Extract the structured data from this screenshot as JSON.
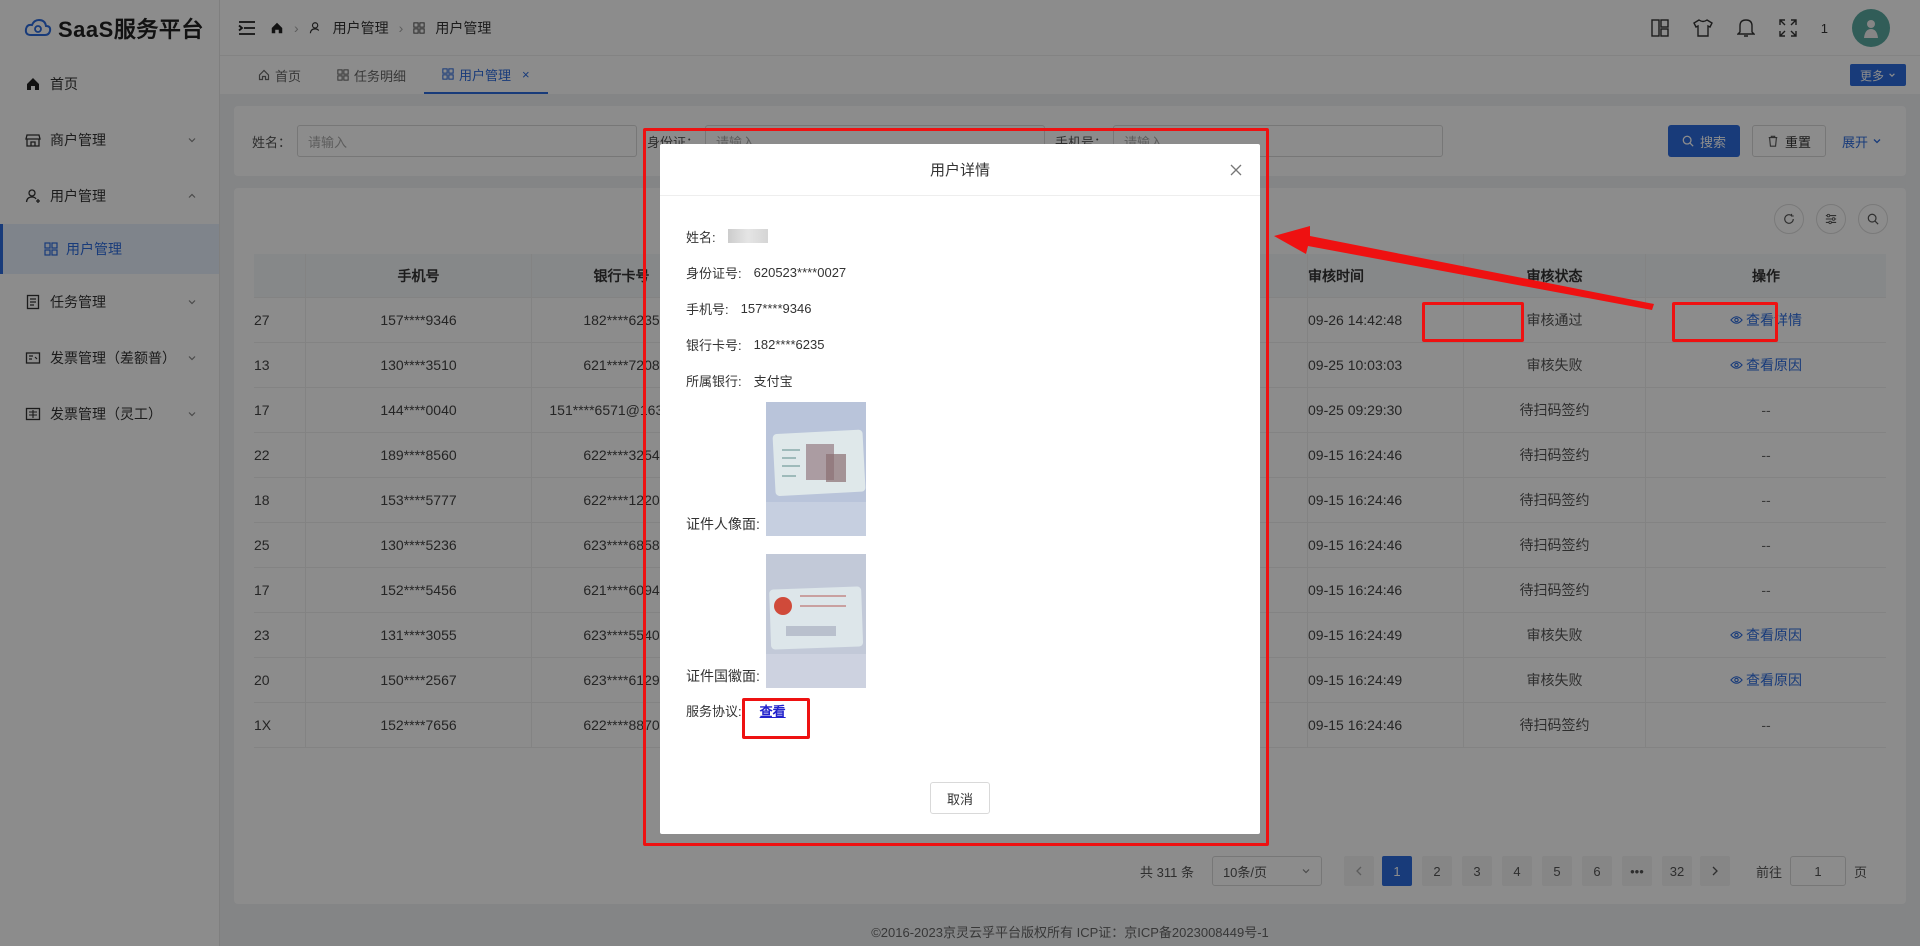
{
  "app": {
    "logo_text": "SaaS服务平台"
  },
  "sidebar": {
    "items": [
      {
        "label": "首页"
      },
      {
        "label": "商户管理"
      },
      {
        "label": "用户管理"
      },
      {
        "label": "任务管理"
      },
      {
        "label": "发票管理（差额普）"
      },
      {
        "label": "发票管理（灵工）"
      }
    ],
    "sub_active": "用户管理"
  },
  "header": {
    "breadcrumb": [
      "用户管理",
      "用户管理"
    ],
    "badge": "1"
  },
  "tabs": {
    "items": [
      {
        "label": "首页"
      },
      {
        "label": "任务明细"
      },
      {
        "label": "用户管理",
        "close": "×"
      }
    ],
    "more": "更多"
  },
  "search": {
    "name_label": "姓名：",
    "name_placeholder": "请输入",
    "id_label": "身份证：",
    "id_placeholder": "请输入",
    "phone_label": "手机号：",
    "phone_placeholder": "请输入",
    "search_btn": "搜索",
    "reset_btn": "重置",
    "expand": "展开"
  },
  "table": {
    "headers": {
      "phone": "手机号",
      "bank": "银行卡号",
      "time": "审核时间",
      "status": "审核状态",
      "op": "操作"
    },
    "rows": [
      {
        "id": "27",
        "phone": "157****9346",
        "bank": "182****6235",
        "time": "09-26 14:42:48",
        "status": "审核通过",
        "op": "查看详情"
      },
      {
        "id": "13",
        "phone": "130****3510",
        "bank": "621****7208",
        "time": "09-25 10:03:03",
        "status": "审核失败",
        "op": "查看原因"
      },
      {
        "id": "17",
        "phone": "144****0040",
        "bank": "151****6571@163.co...",
        "time": "09-25 09:29:30",
        "status": "待扫码签约",
        "op": "--"
      },
      {
        "id": "22",
        "phone": "189****8560",
        "bank": "622****3254",
        "time": "09-15 16:24:46",
        "status": "待扫码签约",
        "op": "--"
      },
      {
        "id": "18",
        "phone": "153****5777",
        "bank": "622****1220",
        "time": "09-15 16:24:46",
        "status": "待扫码签约",
        "op": "--"
      },
      {
        "id": "25",
        "phone": "130****5236",
        "bank": "623****6858",
        "time": "09-15 16:24:46",
        "status": "待扫码签约",
        "op": "--"
      },
      {
        "id": "17",
        "phone": "152****5456",
        "bank": "621****6094",
        "time": "09-15 16:24:46",
        "status": "待扫码签约",
        "op": "--"
      },
      {
        "id": "23",
        "phone": "131****3055",
        "bank": "623****5540",
        "time": "09-15 16:24:49",
        "status": "审核失败",
        "op": "查看原因"
      },
      {
        "id": "20",
        "phone": "150****2567",
        "bank": "623****6129",
        "time": "09-15 16:24:49",
        "status": "审核失败",
        "op": "查看原因"
      },
      {
        "id": "1X",
        "phone": "152****7656",
        "bank": "622****8870",
        "time": "09-15 16:24:46",
        "status": "待扫码签约",
        "op": "--"
      }
    ]
  },
  "pagination": {
    "total": "共 311 条",
    "page_size": "10条/页",
    "pages": [
      "1",
      "2",
      "3",
      "4",
      "5",
      "6",
      "•••",
      "32"
    ],
    "goto_label": "前往",
    "goto_value": "1",
    "page_suffix": "页"
  },
  "footer": {
    "text": "©2016-2023京灵云孚平台版权所有 ICP证：京ICP备2023008449号-1"
  },
  "modal": {
    "title": "用户详情",
    "name_label": "姓名:",
    "id_label": "身份证号:",
    "id_value": "620523****0027",
    "phone_label": "手机号:",
    "phone_value": "157****9346",
    "bank_label": "银行卡号:",
    "bank_value": "182****6235",
    "bank_name_label": "所属银行:",
    "bank_name_value": "支付宝",
    "portrait_label": "证件人像面:",
    "emblem_label": "证件国徽面:",
    "agreement_label": "服务协议:",
    "agreement_link": "查看",
    "cancel": "取消"
  },
  "colors": {
    "primary": "#2d6cdf",
    "annotation": "#ee1111"
  }
}
